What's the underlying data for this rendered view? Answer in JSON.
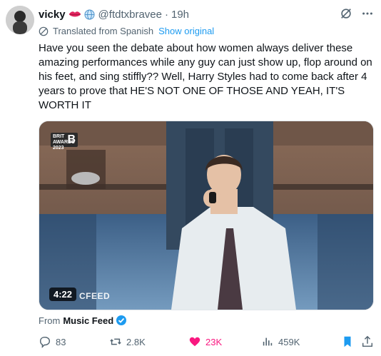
{
  "user": {
    "name": "vicky",
    "handle": "@ftdtxbravee",
    "separator": "·",
    "time": "19h"
  },
  "translation": {
    "label": "Translated from Spanish",
    "link": "Show original"
  },
  "tweet": {
    "text": "Have you seen the debate about how women always deliver these amazing performances while any guy can just show up, flop around on his feet, and sing stiffly?? Well, Harry Styles had to come back after 4 years to prove that HE'S NOT ONE OF THOSE AND YEAH, IT'S WORTH IT"
  },
  "media": {
    "duration": "4:22",
    "watermark": "CFEED",
    "badge_line1": "BRIT",
    "badge_line2": "AWARDS",
    "badge_line3": "2023",
    "badge_big": "B"
  },
  "source": {
    "prefix": "From",
    "name": "Music Feed"
  },
  "actions": {
    "replies": "83",
    "reposts": "2.8K",
    "likes": "23K",
    "views": "459K"
  },
  "colors": {
    "accent": "#1d9bf0",
    "like": "#f91880",
    "muted": "#536471"
  },
  "icons": [
    "lips-icon",
    "globe-icon",
    "grok-icon",
    "more-icon",
    "translate-icon",
    "verified-icon",
    "reply-icon",
    "repost-icon",
    "like-icon",
    "views-icon",
    "bookmark-icon",
    "share-icon"
  ]
}
